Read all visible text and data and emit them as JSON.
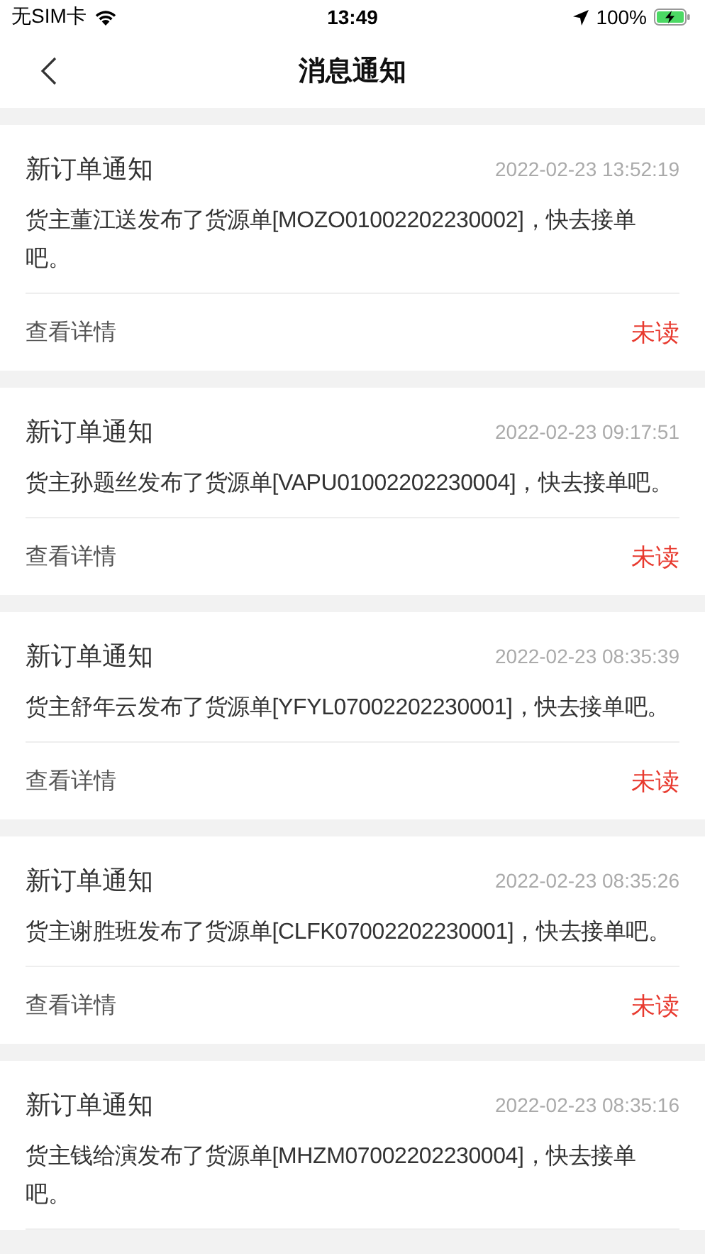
{
  "status_bar": {
    "carrier": "无SIM卡",
    "time": "13:49",
    "battery": "100%"
  },
  "nav": {
    "title": "消息通知"
  },
  "messages": [
    {
      "title": "新订单通知",
      "time": "2022-02-23 13:52:19",
      "text": "货主董江送发布了货源单[MOZO01002202230002]，快去接单吧。",
      "action": "查看详情",
      "status": "未读",
      "unread": true
    },
    {
      "title": "新订单通知",
      "time": "2022-02-23 09:17:51",
      "text": "货主孙题丝发布了货源单[VAPU01002202230004]，快去接单吧。",
      "action": "查看详情",
      "status": "未读",
      "unread": true
    },
    {
      "title": "新订单通知",
      "time": "2022-02-23 08:35:39",
      "text": "货主舒年云发布了货源单[YFYL07002202230001]，快去接单吧。",
      "action": "查看详情",
      "status": "未读",
      "unread": true
    },
    {
      "title": "新订单通知",
      "time": "2022-02-23 08:35:26",
      "text": "货主谢胜班发布了货源单[CLFK07002202230001]，快去接单吧。",
      "action": "查看详情",
      "status": "未读",
      "unread": true
    },
    {
      "title": "新订单通知",
      "time": "2022-02-23 08:35:16",
      "text": "货主钱给演发布了货源单[MHZM07002202230004]，快去接单吧。"
    }
  ]
}
